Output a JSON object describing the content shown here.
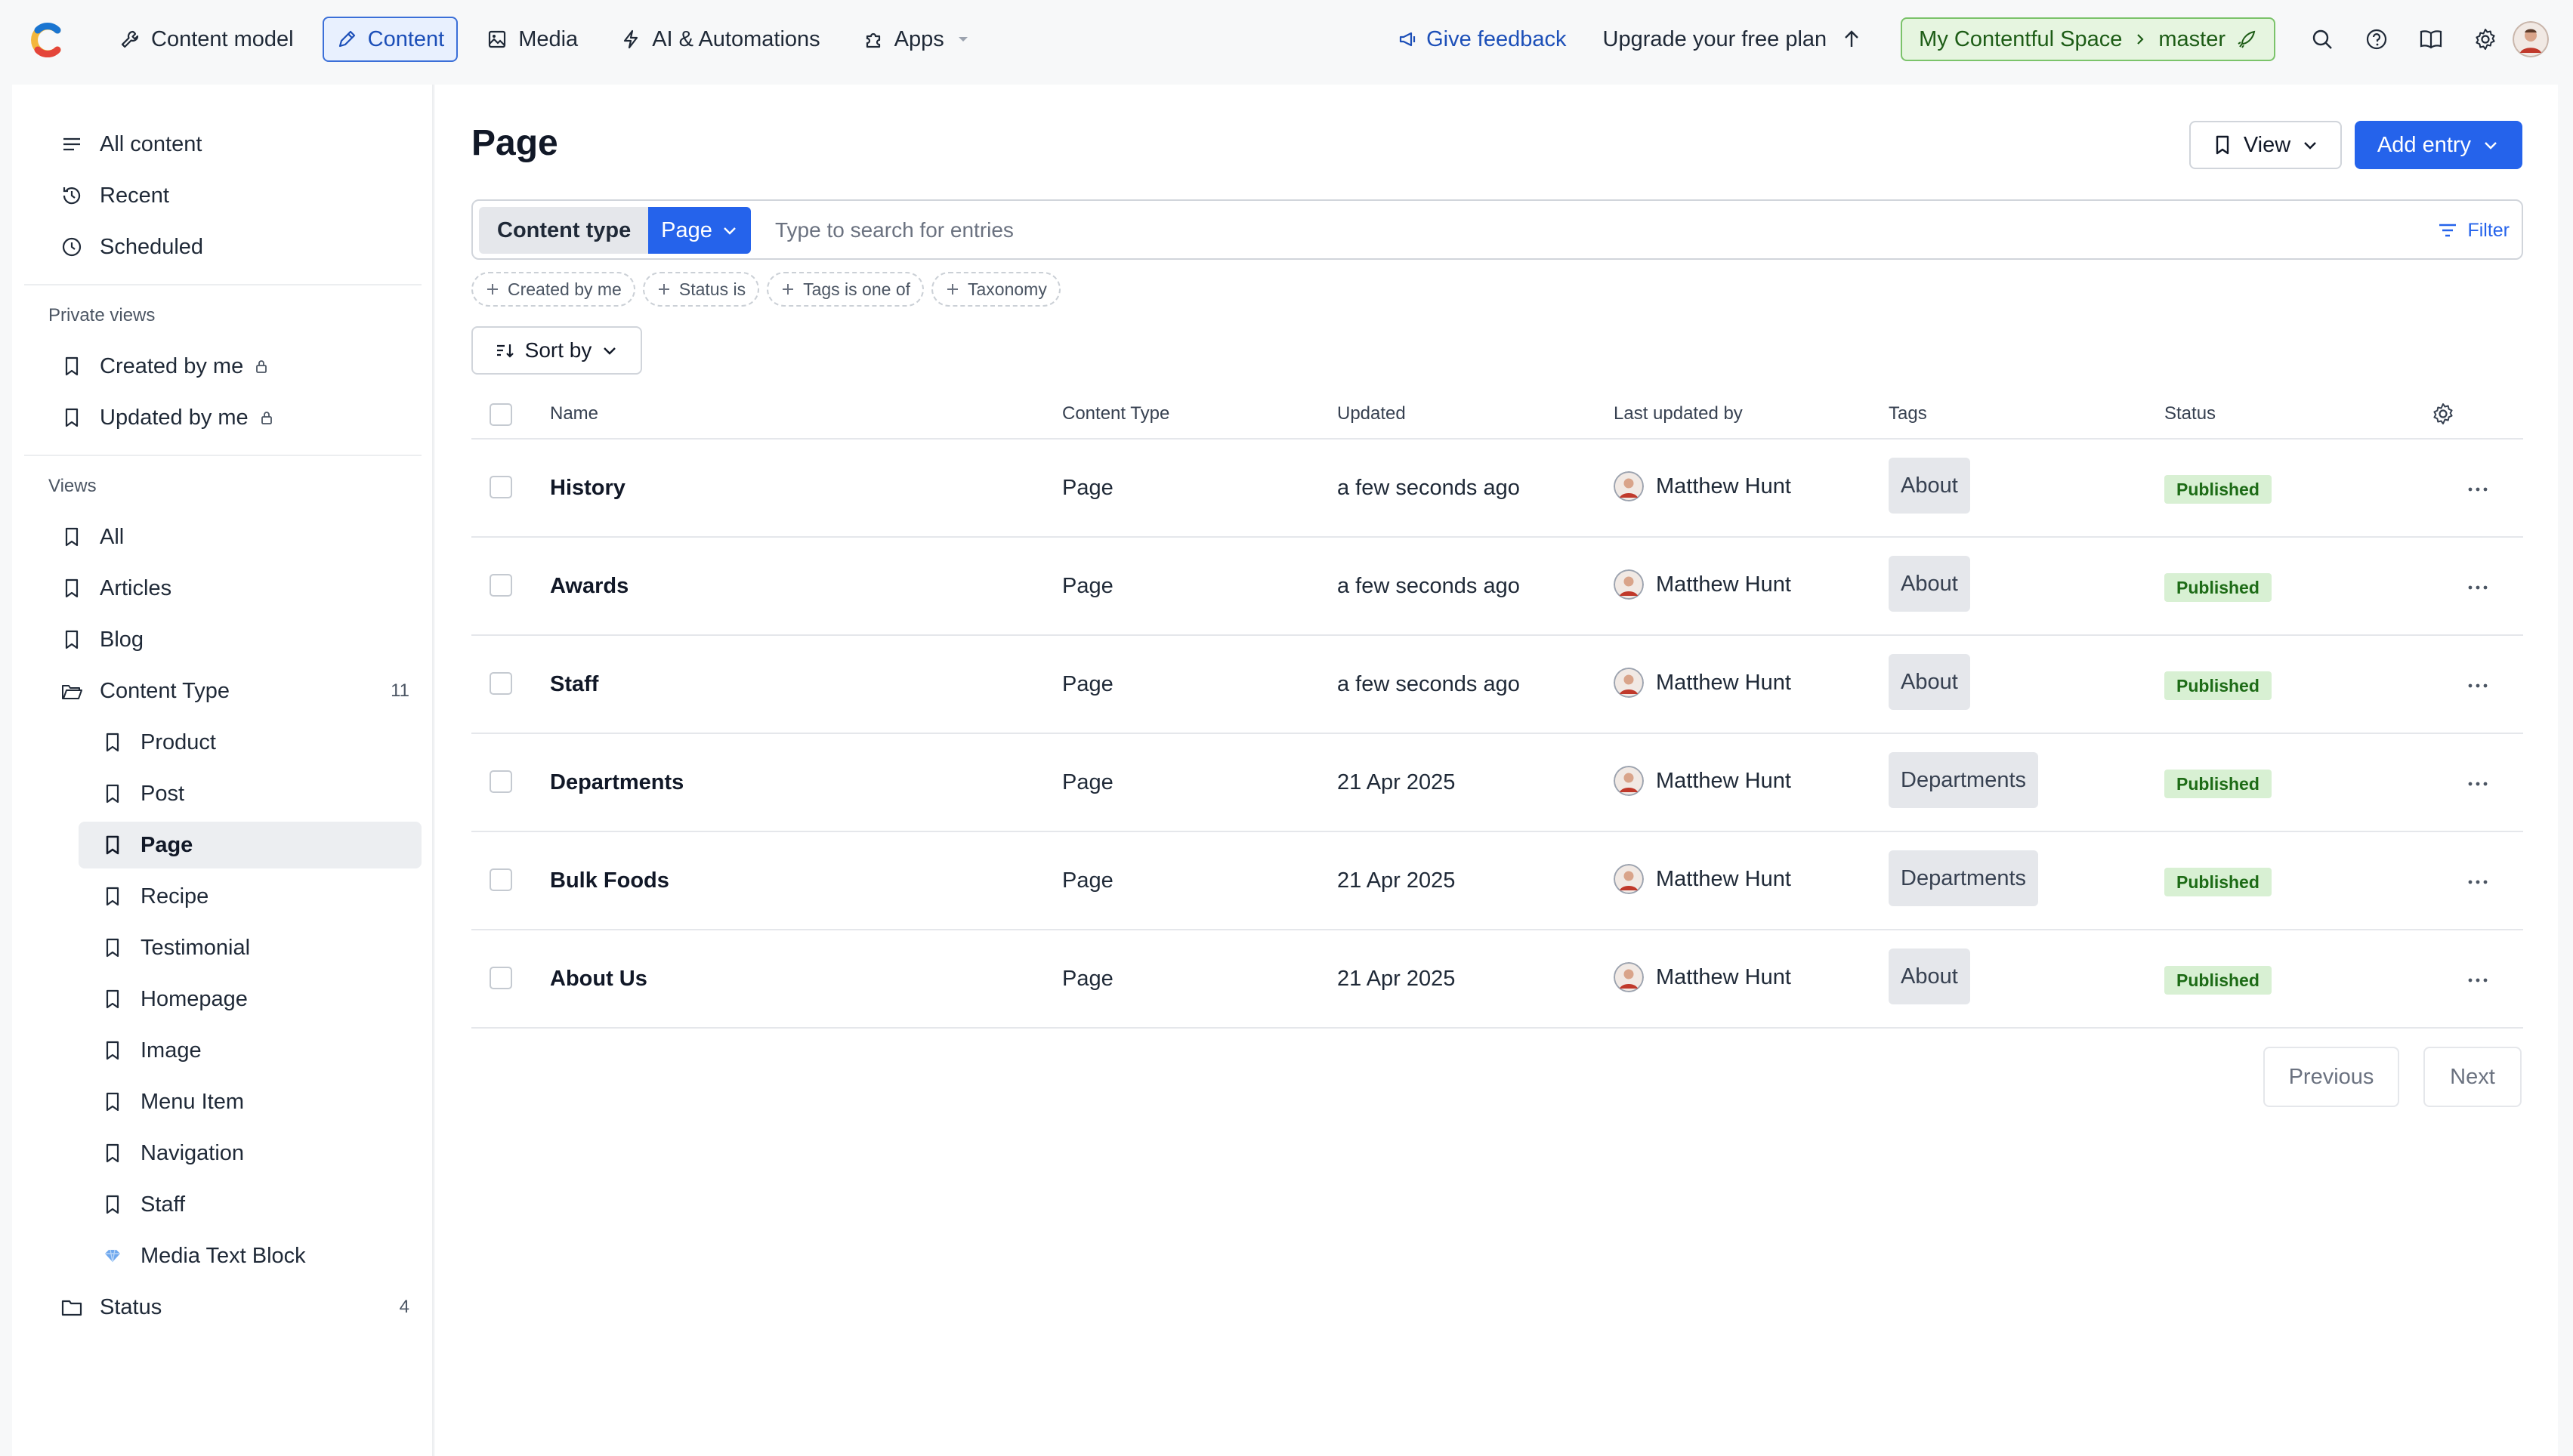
{
  "nav": {
    "items": [
      {
        "label": "Content model",
        "icon": "wrench-icon",
        "active": false
      },
      {
        "label": "Content",
        "icon": "pen-icon",
        "active": true
      },
      {
        "label": "Media",
        "icon": "image-icon",
        "active": false
      },
      {
        "label": "AI & Automations",
        "icon": "bolt-icon",
        "active": false
      },
      {
        "label": "Apps",
        "icon": "puzzle-icon",
        "active": false
      }
    ],
    "feedback": "Give feedback",
    "upgrade": "Upgrade your free plan",
    "space": "My Contentful Space",
    "environment": "master"
  },
  "sidebar": {
    "top": [
      {
        "label": "All content",
        "icon": "menu-icon"
      },
      {
        "label": "Recent",
        "icon": "history-icon"
      },
      {
        "label": "Scheduled",
        "icon": "clock-icon"
      }
    ],
    "private_heading": "Private views",
    "private": [
      {
        "label": "Created by me"
      },
      {
        "label": "Updated by me"
      }
    ],
    "views_heading": "Views",
    "views": [
      {
        "label": "All"
      },
      {
        "label": "Articles"
      },
      {
        "label": "Blog"
      }
    ],
    "content_type_folder": {
      "label": "Content Type",
      "count": "11"
    },
    "content_types": [
      {
        "label": "Product"
      },
      {
        "label": "Post"
      },
      {
        "label": "Page"
      },
      {
        "label": "Recipe"
      },
      {
        "label": "Testimonial"
      },
      {
        "label": "Homepage"
      },
      {
        "label": "Image"
      },
      {
        "label": "Menu Item"
      },
      {
        "label": "Navigation"
      },
      {
        "label": "Staff"
      },
      {
        "label": "Media Text Block"
      }
    ],
    "status_folder": {
      "label": "Status",
      "count": "4"
    }
  },
  "main": {
    "title": "Page",
    "view_label": "View",
    "add_label": "Add entry",
    "content_type_label": "Content type",
    "content_type_value": "Page",
    "search_placeholder": "Type to search for entries",
    "filter_label": "Filter",
    "chips": [
      "Created by me",
      "Status is",
      "Tags is one of",
      "Taxonomy"
    ],
    "sort_label": "Sort by",
    "columns": [
      "Name",
      "Content Type",
      "Updated",
      "Last updated by",
      "Tags",
      "Status"
    ],
    "rows": [
      {
        "name": "History",
        "type": "Page",
        "updated": "a few seconds ago",
        "user": "Matthew Hunt",
        "tag": "About",
        "status": "Published"
      },
      {
        "name": "Awards",
        "type": "Page",
        "updated": "a few seconds ago",
        "user": "Matthew Hunt",
        "tag": "About",
        "status": "Published"
      },
      {
        "name": "Staff",
        "type": "Page",
        "updated": "a few seconds ago",
        "user": "Matthew Hunt",
        "tag": "About",
        "status": "Published"
      },
      {
        "name": "Departments",
        "type": "Page",
        "updated": "21 Apr 2025",
        "user": "Matthew Hunt",
        "tag": "Departments",
        "status": "Published"
      },
      {
        "name": "Bulk Foods",
        "type": "Page",
        "updated": "21 Apr 2025",
        "user": "Matthew Hunt",
        "tag": "Departments",
        "status": "Published"
      },
      {
        "name": "About Us",
        "type": "Page",
        "updated": "21 Apr 2025",
        "user": "Matthew Hunt",
        "tag": "About",
        "status": "Published"
      }
    ],
    "previous_label": "Previous",
    "next_label": "Next"
  },
  "colors": {
    "accent": "#2563eb",
    "published_bg": "#d8f0d3",
    "published_text": "#1d6b16",
    "space_bg": "#e6f5e0"
  }
}
